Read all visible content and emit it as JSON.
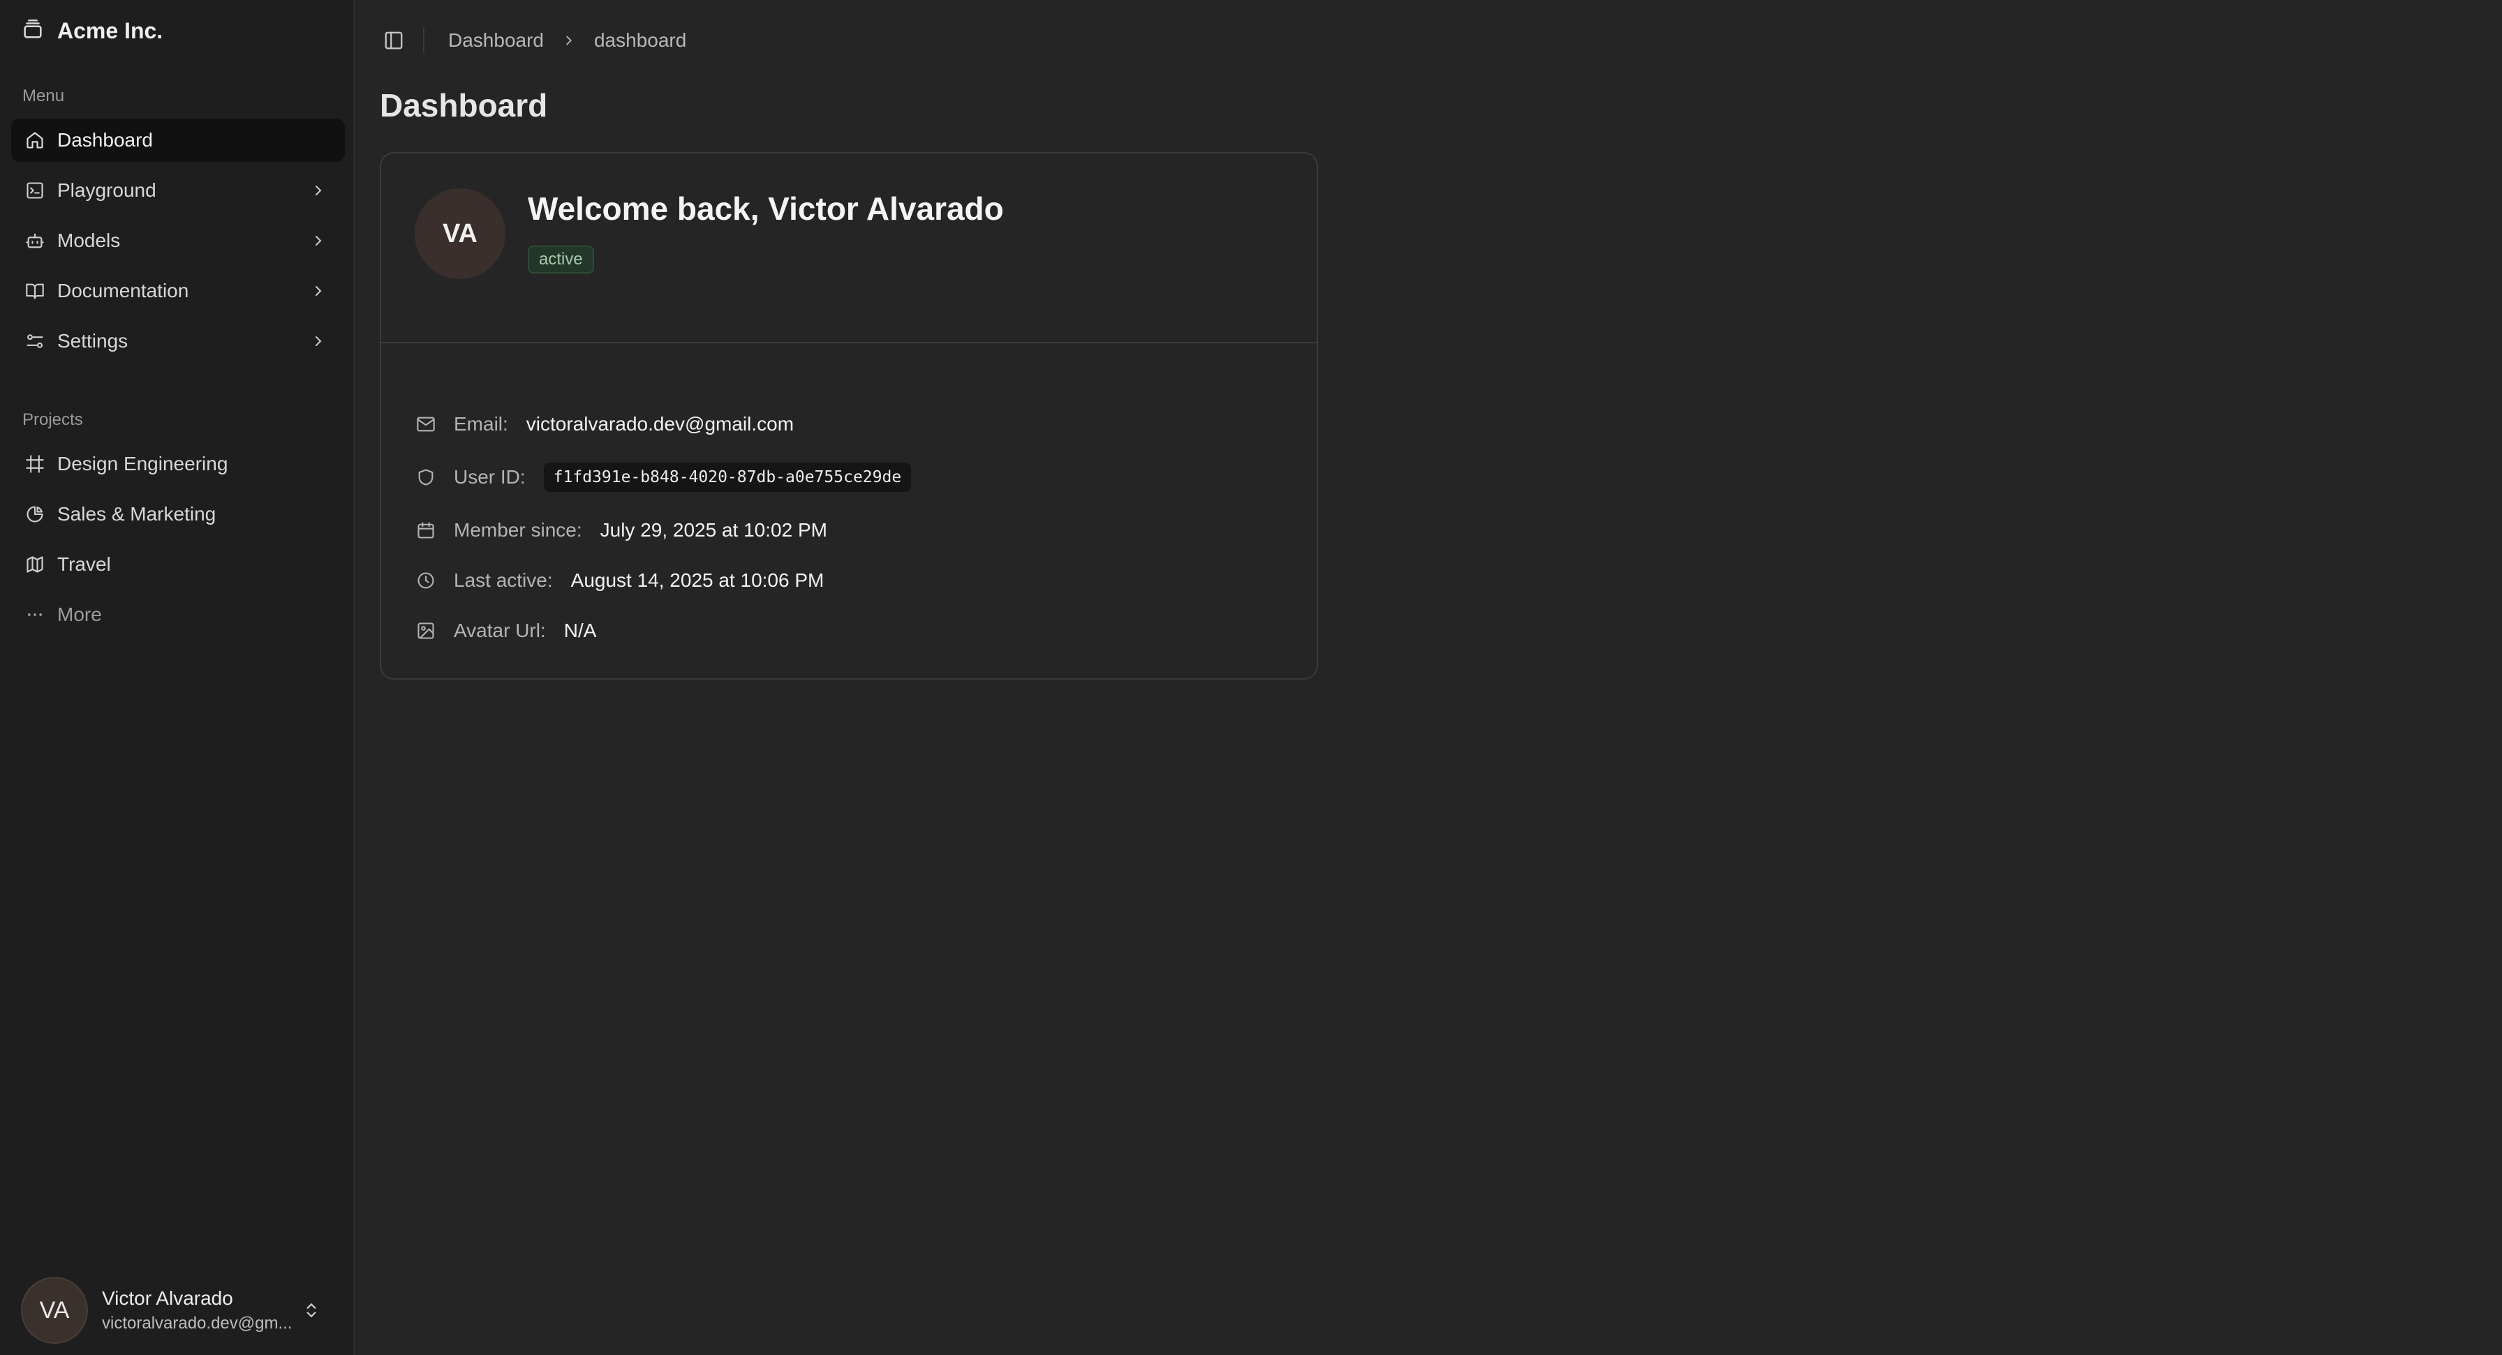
{
  "app": {
    "brand": "Acme Inc."
  },
  "sidebar": {
    "menu_label": "Menu",
    "menu_items": [
      {
        "label": "Dashboard",
        "icon": "home-icon",
        "active": true
      },
      {
        "label": "Playground",
        "icon": "terminal-icon"
      },
      {
        "label": "Models",
        "icon": "bot-icon"
      },
      {
        "label": "Documentation",
        "icon": "book-icon"
      },
      {
        "label": "Settings",
        "icon": "settings-icon"
      }
    ],
    "projects_label": "Projects",
    "project_items": [
      {
        "label": "Design Engineering",
        "icon": "frame-icon"
      },
      {
        "label": "Sales & Marketing",
        "icon": "pie-chart-icon"
      },
      {
        "label": "Travel",
        "icon": "map-icon"
      },
      {
        "label": "More",
        "icon": "more-icon"
      }
    ],
    "user": {
      "initials": "VA",
      "name": "Victor Alvarado",
      "email": "victoralvarado.dev@gm..."
    }
  },
  "header": {
    "breadcrumb": [
      "Dashboard",
      "dashboard"
    ]
  },
  "main": {
    "title": "Dashboard",
    "profile": {
      "initials": "VA",
      "welcome": "Welcome back, Victor Alvarado",
      "status": "active",
      "status_color": "#22372a",
      "fields": [
        {
          "label": "Email:",
          "value": "victoralvarado.dev@gmail.com",
          "icon": "mail-icon"
        },
        {
          "label": "User ID:",
          "value": "f1fd391e-b848-4020-87db-a0e755ce29de",
          "icon": "shield-icon"
        },
        {
          "label": "Member since:",
          "value": "July 29, 2025 at 10:02 PM",
          "icon": "calendar-icon"
        },
        {
          "label": "Last active:",
          "value": "August 14, 2025 at 10:06 PM",
          "icon": "clock-icon"
        },
        {
          "label": "Avatar Url:",
          "value": "N/A",
          "icon": "image-icon"
        }
      ]
    }
  }
}
